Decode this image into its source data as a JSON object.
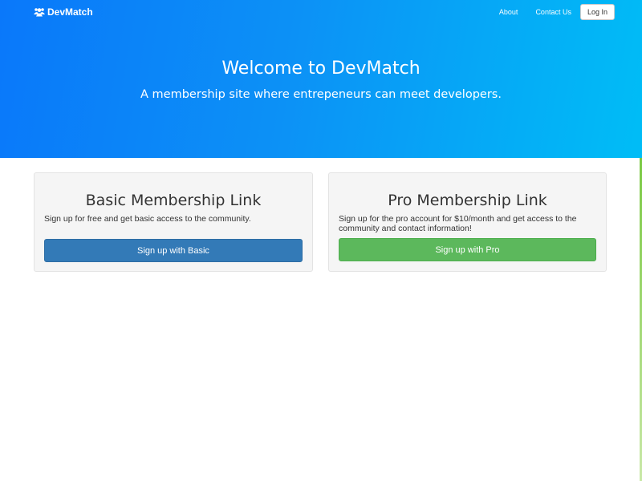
{
  "nav": {
    "brand": "DevMatch",
    "brand_icon": "users-icon",
    "links": [
      "About",
      "Contact Us"
    ],
    "login_label": "Log In"
  },
  "hero": {
    "title": "Welcome to DevMatch",
    "subtitle": "A membership site where entrepeneurs can meet developers."
  },
  "plans": {
    "basic": {
      "title": "Basic Membership Link",
      "description": "Sign up for free and get basic access to the community.",
      "button": "Sign up with Basic"
    },
    "pro": {
      "title": "Pro Membership Link",
      "description": "Sign up for the pro account for $10/month and get access to the community and contact information!",
      "button": "Sign up with Pro"
    }
  },
  "colors": {
    "hero_gradient_start": "#0a78fa",
    "hero_gradient_end": "#00bdf6",
    "basic_button": "#337ab7",
    "pro_button": "#5cb85c",
    "card_background": "#f5f5f5"
  }
}
